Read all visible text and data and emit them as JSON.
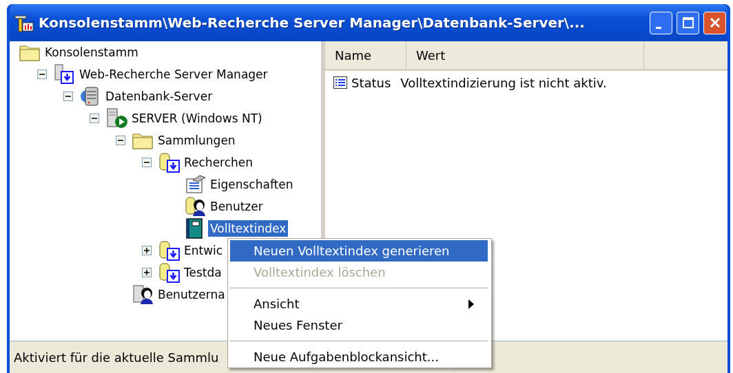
{
  "window": {
    "title": "Konsolenstamm\\Web-Recherche Server Manager\\Datenbank-Server\\..."
  },
  "tree": {
    "nodes": [
      {
        "label": "Konsolenstamm",
        "kind": "folder",
        "selected": false,
        "children": [
          {
            "label": "Web-Recherche Server Manager",
            "kind": "manager",
            "expanded": true,
            "selected": false,
            "children": [
              {
                "label": "Datenbank-Server",
                "kind": "database",
                "expanded": true,
                "selected": false,
                "children": [
                  {
                    "label": "SERVER (Windows NT)",
                    "kind": "server",
                    "expanded": true,
                    "selected": false,
                    "children": [
                      {
                        "label": "Sammlungen",
                        "kind": "folder",
                        "expanded": true,
                        "selected": false,
                        "children": [
                          {
                            "label": "Recherchen",
                            "kind": "collection",
                            "expanded": true,
                            "selected": false,
                            "children": [
                              {
                                "label": "Eigenschaften",
                                "kind": "properties",
                                "selected": false
                              },
                              {
                                "label": "Benutzer",
                                "kind": "users",
                                "selected": false
                              },
                              {
                                "label": "Volltextindex",
                                "kind": "book",
                                "selected": true
                              }
                            ]
                          },
                          {
                            "label": "Entwic",
                            "kind": "collection",
                            "expanded": false,
                            "selected": false
                          },
                          {
                            "label": "Testda",
                            "kind": "collection",
                            "expanded": false,
                            "selected": false
                          }
                        ]
                      },
                      {
                        "label": "Benutzerna",
                        "kind": "user-server",
                        "selected": false
                      }
                    ]
                  }
                ]
              }
            ]
          }
        ]
      }
    ]
  },
  "list": {
    "columns": [
      "Name",
      "Wert"
    ],
    "rows": [
      {
        "name": "Status",
        "value": "Volltextindizierung ist nicht aktiv."
      }
    ]
  },
  "status_bar": {
    "text": "Aktiviert für die aktuelle Sammlu"
  },
  "context_menu": [
    {
      "kind": "item",
      "label": "Neuen Volltextindex generieren",
      "selected": true,
      "disabled": false
    },
    {
      "kind": "item",
      "label": "Volltextindex löschen",
      "selected": false,
      "disabled": true
    },
    {
      "kind": "separator"
    },
    {
      "kind": "item",
      "label": "Ansicht",
      "selected": false,
      "disabled": false,
      "submenu": true
    },
    {
      "kind": "item",
      "label": "Neues Fenster",
      "selected": false,
      "disabled": false
    },
    {
      "kind": "separator"
    },
    {
      "kind": "item",
      "label": "Neue Aufgabenblockansicht...",
      "selected": false,
      "disabled": false
    }
  ]
}
